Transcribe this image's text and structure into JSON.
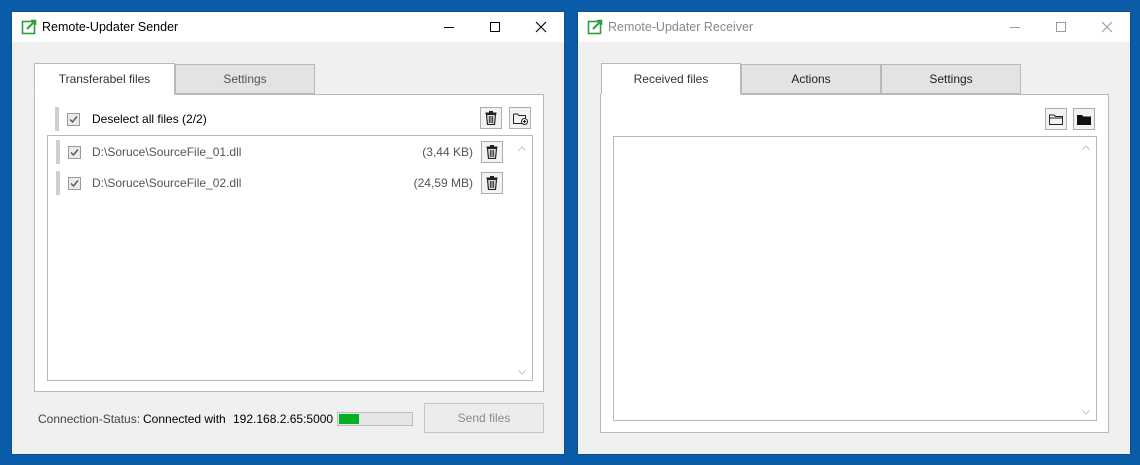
{
  "sender": {
    "title": "Remote-Updater Sender",
    "tabs": [
      {
        "label": "Transferabel files",
        "selected": true
      },
      {
        "label": "Settings",
        "selected": false
      }
    ],
    "select_all": {
      "label": "Deselect all files (2/2)",
      "checked": true
    },
    "files": [
      {
        "path": "D:\\Soruce\\SourceFile_01.dll",
        "size": "(3,44 KB)",
        "checked": true
      },
      {
        "path": "D:\\Soruce\\SourceFile_02.dll",
        "size": "(24,59 MB)",
        "checked": true
      }
    ],
    "status": {
      "label": "Connection-Status:",
      "value": "Connected with",
      "address": "192.168.2.65:5000",
      "progress_fraction": 0.28
    },
    "send_button": {
      "label": "Send files",
      "enabled": false
    }
  },
  "receiver": {
    "title": "Remote-Updater Receiver",
    "tabs": [
      {
        "label": "Received files",
        "selected": true
      },
      {
        "label": "Actions",
        "selected": false
      },
      {
        "label": "Settings",
        "selected": false
      }
    ]
  },
  "colors": {
    "desktop": "#0a5ba8",
    "progress_fill": "#06b025",
    "app_icon": "#2e9e3e"
  },
  "icons": {
    "app": "edit-square-icon",
    "delete": "trash-icon",
    "add_folder": "folder-add-icon",
    "open_folder": "folder-outline-icon",
    "folder": "folder-filled-icon"
  }
}
